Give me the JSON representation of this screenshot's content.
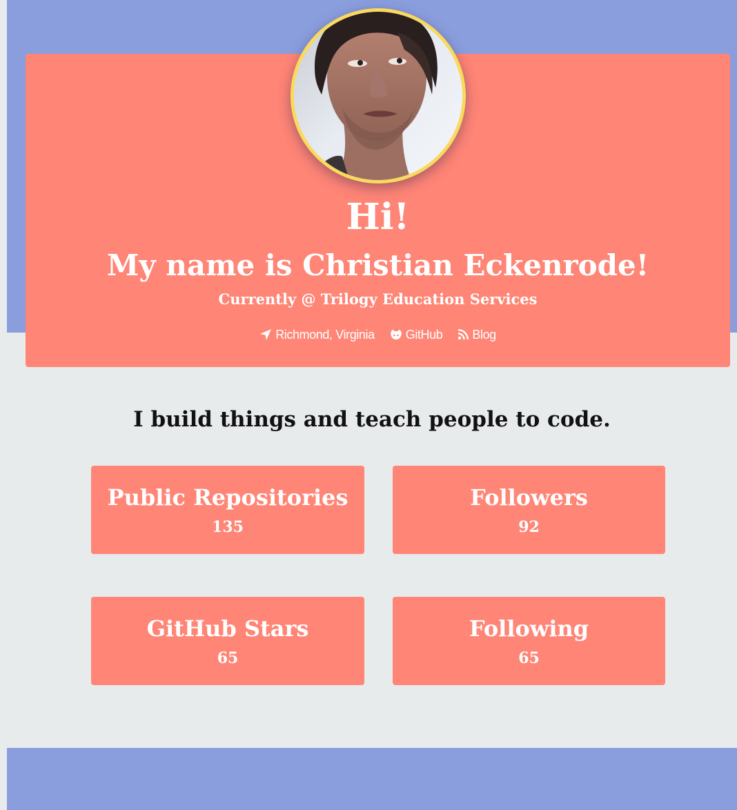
{
  "hero": {
    "greeting": "Hi!",
    "name_line": "My name is Christian Eckenrode!",
    "job_line": "Currently @ Trilogy Education Services",
    "avatar_icon": "profile-photo",
    "links": [
      {
        "icon": "location-arrow-icon",
        "label": "Richmond, Virginia"
      },
      {
        "icon": "github-icon",
        "label": "GitHub"
      },
      {
        "icon": "rss-icon",
        "label": "Blog"
      }
    ]
  },
  "main": {
    "tagline": "I build things and teach people to code.",
    "stats": [
      {
        "title": "Public Repositories",
        "value": "135"
      },
      {
        "title": "Followers",
        "value": "92"
      },
      {
        "title": "GitHub Stars",
        "value": "65"
      },
      {
        "title": "Following",
        "value": "65"
      }
    ]
  },
  "colors": {
    "band": "#8a9ede",
    "card": "#ff8576",
    "background": "#e8ebec",
    "avatar_ring": "#f9da5c"
  }
}
